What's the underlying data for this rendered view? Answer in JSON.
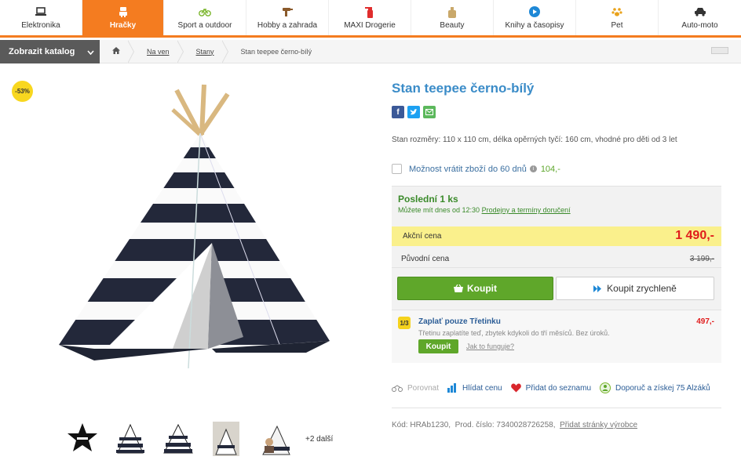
{
  "nav": {
    "categories": [
      {
        "label": "Elektronika",
        "icon": "laptop-icon"
      },
      {
        "label": "Hračky",
        "icon": "robot-icon"
      },
      {
        "label": "Sport a outdoor",
        "icon": "bicycle-icon"
      },
      {
        "label": "Hobby a zahrada",
        "icon": "drill-icon"
      },
      {
        "label": "MAXI Drogerie",
        "icon": "spray-bottle-icon"
      },
      {
        "label": "Beauty",
        "icon": "perfume-icon"
      },
      {
        "label": "Knihy a časopisy",
        "icon": "play-circle-icon"
      },
      {
        "label": "Pet",
        "icon": "paw-icon"
      },
      {
        "label": "Auto-moto",
        "icon": "car-icon"
      }
    ],
    "active_index": 1,
    "accent_color": "#f47c20"
  },
  "breadcrumb": {
    "catalog_button": "Zobrazit katalog",
    "items": [
      "Na ven",
      "Stany",
      "Stan teepee černo-bílý"
    ]
  },
  "product": {
    "discount_badge": "-53%",
    "title": "Stan teepee černo-bílý",
    "description": "Stan rozměry: 110 x 110 cm, délka opěrných tyčí: 160 cm, vhodné pro děti od 3 let",
    "return_option": {
      "label": "Možnost vrátit zboží do 60 dnů",
      "price": "104,-"
    },
    "thumbnails_more": "+2 další"
  },
  "buybox": {
    "stock": "Poslední 1 ks",
    "delivery_text": "Můžete mít dnes od 12:30",
    "delivery_link": "Prodejny a termíny doručení",
    "sale_label": "Akční cena",
    "sale_price": "1 490,-",
    "orig_label": "Původní cena",
    "orig_price": "3 199,-",
    "buy_button": "Koupit",
    "fast_button": "Koupit zrychleně",
    "split": {
      "badge": "1/3",
      "title": "Zaplať pouze Třetinku",
      "price": "497,-",
      "desc": "Třetinu zaplatíte teď, zbytek kdykoli do tří měsíců. Bez úroků.",
      "button": "Koupit",
      "help": "Jak to funguje?"
    }
  },
  "actions": {
    "compare": "Porovnat",
    "watch": "Hlídat cenu",
    "wishlist": "Přidat do seznamu",
    "recommend": "Doporuč a získej 75 Alzáků"
  },
  "codes": {
    "code": "Kód: HRAb1230,",
    "prod": "Prod. číslo: 7340028726258,",
    "maker_link": "Přidat stránky výrobce"
  }
}
